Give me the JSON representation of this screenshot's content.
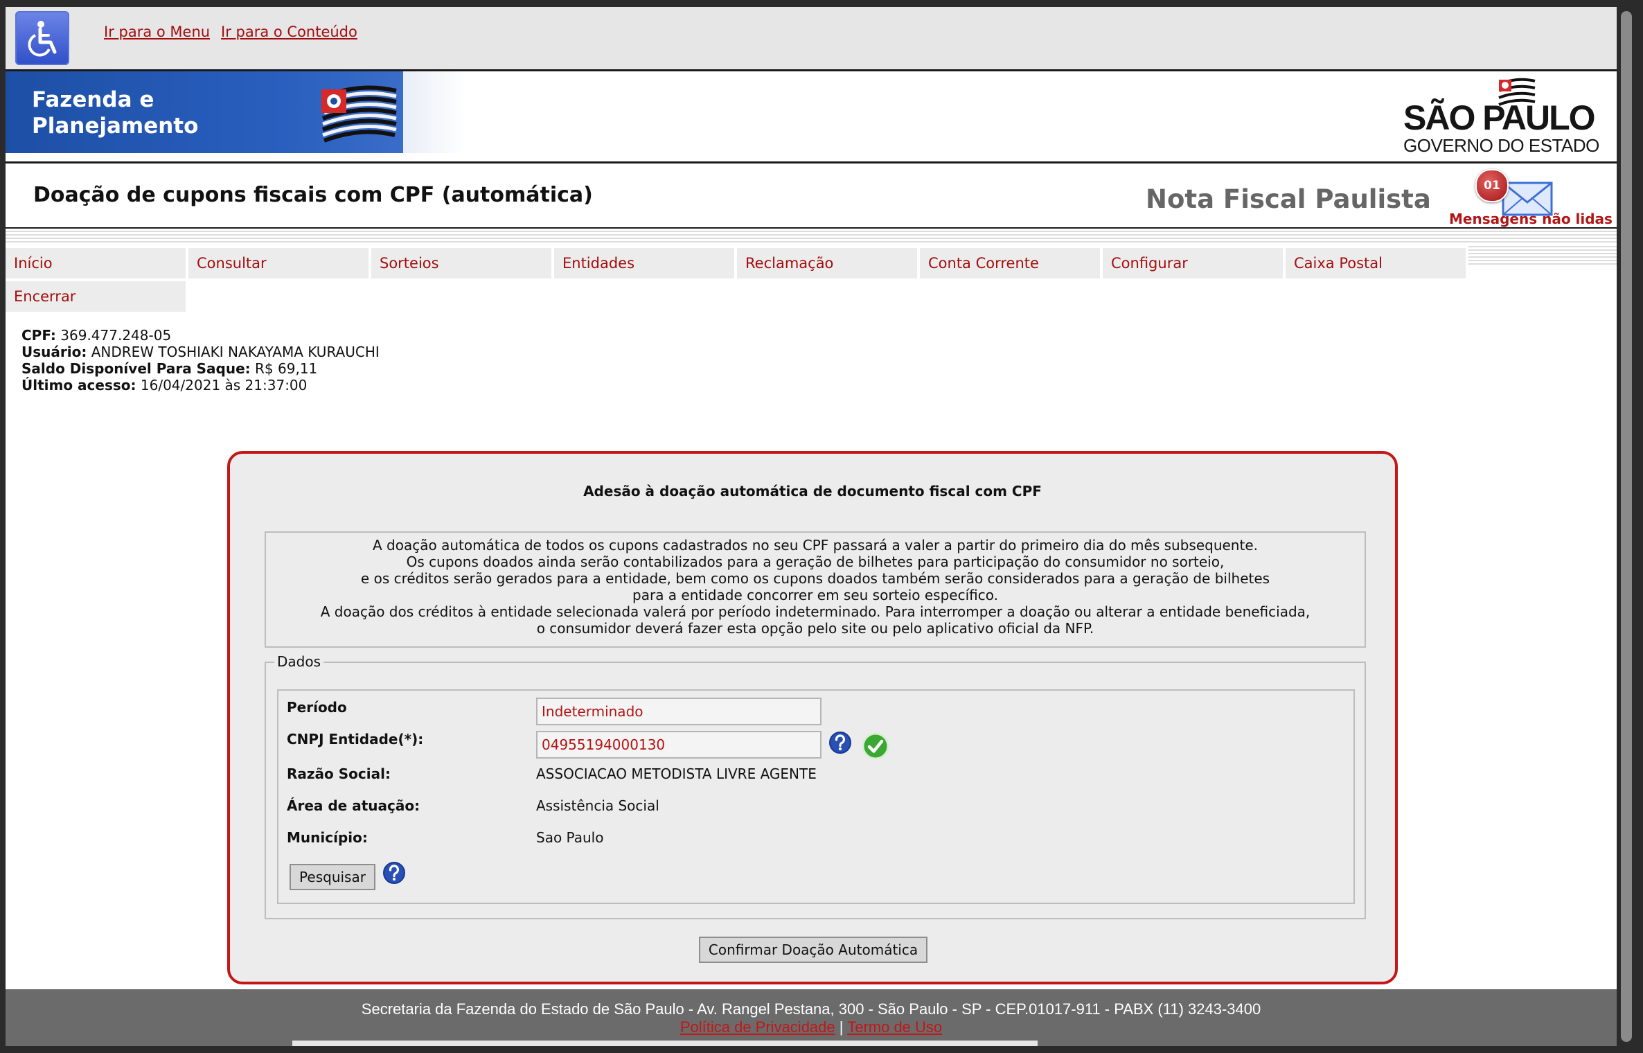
{
  "skip_links": {
    "menu": "Ir para o Menu",
    "content": "Ir para o Conteúdo"
  },
  "banner": {
    "brand": "Fazenda e\nPlanejamento",
    "sp_title": "SÃO PAULO",
    "sp_subtitle": "GOVERNO DO ESTADO"
  },
  "header": {
    "page_title": "Doação de cupons fiscais com CPF (automática)",
    "app_name": "Nota Fiscal Paulista",
    "messages_count": "01",
    "messages_label": "Mensagens não lidas"
  },
  "menu": {
    "items": [
      "Início",
      "Consultar",
      "Sorteios",
      "Entidades",
      "Reclamação",
      "Conta Corrente",
      "Configurar",
      "Caixa Postal",
      "Encerrar"
    ]
  },
  "user": {
    "cpf_label": "CPF:",
    "cpf": "369.477.248-05",
    "name_label": "Usuário:",
    "name": "ANDREW TOSHIAKI NAKAYAMA KURAUCHI",
    "balance_label": "Saldo Disponível Para Saque:",
    "balance": "R$ 69,11",
    "last_access_label": "Último acesso:",
    "last_access": "16/04/2021 às 21:37:00"
  },
  "form": {
    "title": "Adesão à doação automática de documento fiscal com CPF",
    "info_lines": [
      "A doação automática de todos os cupons cadastrados no seu CPF passará a valer a partir do primeiro dia do mês subsequente.",
      "Os cupons doados ainda serão contabilizados para a geração de bilhetes para participação do consumidor no sorteio,",
      "e os créditos serão gerados para a entidade, bem como os cupons doados também serão considerados para a geração de bilhetes",
      "para a entidade concorrer em seu sorteio específico.",
      "A doação dos créditos à entidade selecionada valerá por período indeterminado. Para interromper a doação ou alterar a entidade beneficiada,",
      "o consumidor deverá fazer esta opção pelo site ou pelo aplicativo oficial da NFP."
    ],
    "legend": "Dados",
    "periodo_label": "Período",
    "periodo_value": "Indeterminado",
    "cnpj_label": "CNPJ Entidade(*):",
    "cnpj_value": "04955194000130",
    "razao_label": "Razão Social:",
    "razao_value": "ASSOCIACAO METODISTA LIVRE AGENTE",
    "area_label": "Área de atuação:",
    "area_value": "Assistência Social",
    "municipio_label": "Município:",
    "municipio_value": "Sao Paulo",
    "search_button": "Pesquisar",
    "confirm_button": "Confirmar Doação Automática"
  },
  "footer": {
    "address": "Secretaria da Fazenda do Estado de São Paulo - Av. Rangel Pestana, 300 - São Paulo - SP - CEP.01017-911 - PABX (11) 3243-3400",
    "privacy": "Política de Privacidade",
    "separator": "|",
    "terms": "Termo de Uso"
  },
  "colors": {
    "accent_red": "#c41616",
    "link_red": "#a30d0d",
    "banner_blue": "#1d4fa5",
    "footer_gray": "#6b6b6b"
  }
}
